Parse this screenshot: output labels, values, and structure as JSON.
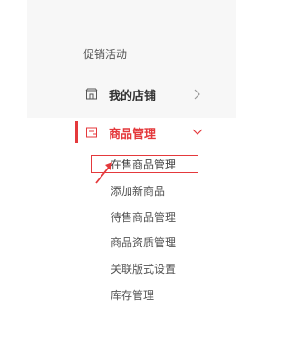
{
  "sidebar": {
    "promo_label": "促销活动",
    "store": {
      "label": "我的店铺",
      "icon": "store-icon"
    },
    "goods": {
      "label": "商品管理",
      "icon": "goods-icon",
      "accent": "#e4393c",
      "subitems": [
        {
          "label": "在售商品管理"
        },
        {
          "label": "添加新商品"
        },
        {
          "label": "待售商品管理"
        },
        {
          "label": "商品资质管理"
        },
        {
          "label": "关联版式设置"
        },
        {
          "label": "库存管理"
        }
      ]
    }
  }
}
